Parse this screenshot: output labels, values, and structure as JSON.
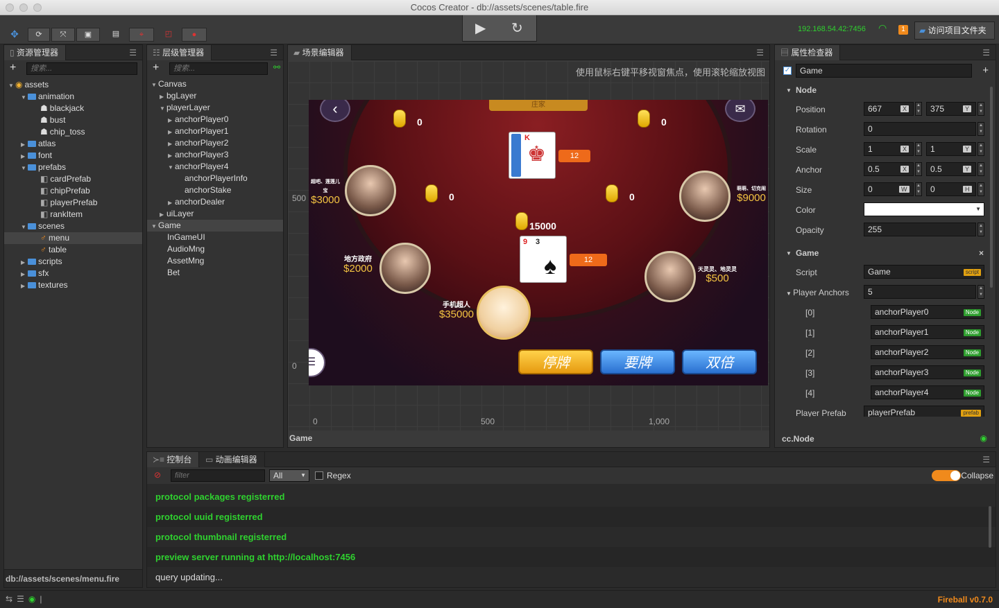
{
  "window": {
    "title": "Cocos Creator - db://assets/scenes/table.fire"
  },
  "toolbar": {
    "ip": "192.168.54.42:7456",
    "notification_count": "1",
    "open_project_label": "访问项目文件夹"
  },
  "assets_panel": {
    "title": "资源管理器",
    "search_placeholder": "搜索...",
    "footer_path": "db://assets/scenes/menu.fire",
    "items": [
      {
        "label": "assets"
      },
      {
        "label": "animation"
      },
      {
        "label": "blackjack"
      },
      {
        "label": "bust"
      },
      {
        "label": "chip_toss"
      },
      {
        "label": "atlas"
      },
      {
        "label": "font"
      },
      {
        "label": "prefabs"
      },
      {
        "label": "cardPrefab"
      },
      {
        "label": "chipPrefab"
      },
      {
        "label": "playerPrefab"
      },
      {
        "label": "rankItem"
      },
      {
        "label": "scenes"
      },
      {
        "label": "menu"
      },
      {
        "label": "table"
      },
      {
        "label": "scripts"
      },
      {
        "label": "sfx"
      },
      {
        "label": "textures"
      }
    ]
  },
  "hierarchy_panel": {
    "title": "层级管理器",
    "search_placeholder": "搜索...",
    "items": [
      {
        "label": "Canvas"
      },
      {
        "label": "bgLayer"
      },
      {
        "label": "playerLayer"
      },
      {
        "label": "anchorPlayer0"
      },
      {
        "label": "anchorPlayer1"
      },
      {
        "label": "anchorPlayer2"
      },
      {
        "label": "anchorPlayer3"
      },
      {
        "label": "anchorPlayer4"
      },
      {
        "label": "anchorPlayerInfo"
      },
      {
        "label": "anchorStake"
      },
      {
        "label": "anchorDealer"
      },
      {
        "label": "uiLayer"
      },
      {
        "label": "Game"
      },
      {
        "label": "InGameUI"
      },
      {
        "label": "AudioMng"
      },
      {
        "label": "AssetMng"
      },
      {
        "label": "Bet"
      }
    ]
  },
  "scene_panel": {
    "title": "场景编辑器",
    "hint": "使用鼠标右键平移视窗焦点，使用滚轮缩放视图",
    "footer": "Game",
    "ruler": {
      "y500": "500",
      "y0": "0",
      "x0": "0",
      "x500": "500",
      "x1000": "1,000"
    }
  },
  "game": {
    "banner": "庄家",
    "chips": [
      {
        "value": "0"
      },
      {
        "value": "0"
      },
      {
        "value": "0"
      },
      {
        "value": "0"
      },
      {
        "value": "15000"
      }
    ],
    "dealer_tag": "12",
    "player_tag": "12",
    "card_dealer": "K",
    "card_p1": "9",
    "card_p2": "3",
    "players": [
      {
        "name": "超吧、莲莲儿宝",
        "money": "$3000"
      },
      {
        "name": "萌萌、切克闹",
        "money": "$9000"
      },
      {
        "name": "地方政府",
        "money": "$2000"
      },
      {
        "name": "天灵灵、地灵灵",
        "money": "$500"
      },
      {
        "name": "手机超人",
        "money": "$35000"
      }
    ],
    "buttons": {
      "stand": "停牌",
      "hit": "要牌",
      "double": "双倍"
    }
  },
  "inspector": {
    "title": "属性检查器",
    "node_name": "Game",
    "node_section": "Node",
    "position": {
      "label": "Position",
      "x": "667",
      "y": "375"
    },
    "rotation": {
      "label": "Rotation",
      "value": "0"
    },
    "scale": {
      "label": "Scale",
      "x": "1",
      "y": "1"
    },
    "anchor": {
      "label": "Anchor",
      "x": "0.5",
      "y": "0.5"
    },
    "size": {
      "label": "Size",
      "w": "0",
      "h": "0"
    },
    "color": {
      "label": "Color",
      "value": "#ffffff"
    },
    "opacity": {
      "label": "Opacity",
      "value": "255"
    },
    "game_section": "Game",
    "script": {
      "label": "Script",
      "value": "Game",
      "tag": "script"
    },
    "player_anchors": {
      "label": "Player Anchors",
      "count": "5",
      "items": [
        {
          "index": "[0]",
          "value": "anchorPlayer0",
          "tag": "Node"
        },
        {
          "index": "[1]",
          "value": "anchorPlayer1",
          "tag": "Node"
        },
        {
          "index": "[2]",
          "value": "anchorPlayer2",
          "tag": "Node"
        },
        {
          "index": "[3]",
          "value": "anchorPlayer3",
          "tag": "Node"
        },
        {
          "index": "[4]",
          "value": "anchorPlayer4",
          "tag": "Node"
        }
      ]
    },
    "player_prefab": {
      "label": "Player Prefab",
      "value": "playerPrefab",
      "tag": "prefab"
    },
    "footer": "cc.Node"
  },
  "console": {
    "tab_console": "控制台",
    "tab_animation": "动画编辑器",
    "filter_placeholder": "filter",
    "level": "All",
    "regex_label": "Regex",
    "collapse_label": "Collapse",
    "logs": [
      "protocol packages registerred",
      "protocol uuid registerred",
      "protocol thumbnail registerred",
      "preview server running at http://localhost:7456",
      "query updating..."
    ]
  },
  "status": {
    "version": "Fireball v0.7.0"
  }
}
